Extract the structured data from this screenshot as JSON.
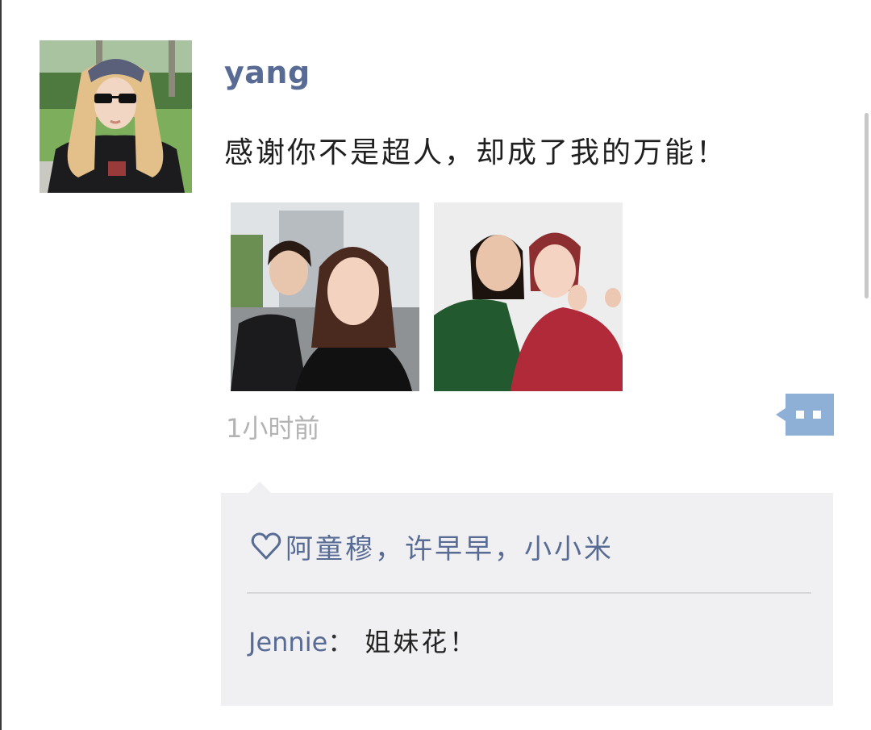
{
  "post": {
    "author": "yang",
    "text": "感谢你不是超人，却成了我的万能！",
    "timestamp": "1小时前"
  },
  "photos": [
    {
      "name": "post-photo-1"
    },
    {
      "name": "post-photo-2"
    }
  ],
  "likes": {
    "icon": "heart-outline-icon",
    "names": "阿童穆，许早早，小小米"
  },
  "comments": [
    {
      "author": "Jennie",
      "separator": "：",
      "text": "姐妹花！"
    }
  ],
  "colors": {
    "link": "#576b95",
    "timestamp": "#b3b3b3",
    "interaction_bg": "#f0f0f2",
    "comment_button": "#8fb0d6"
  }
}
